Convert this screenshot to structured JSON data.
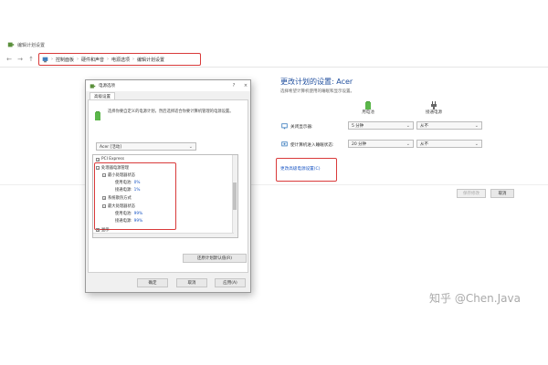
{
  "window": {
    "title": "编辑计划设置"
  },
  "address": {
    "back": "←",
    "forward": "→",
    "up": "↑",
    "crumbs": [
      "控制面板",
      "硬件和声音",
      "电源选项",
      "编辑计划设置"
    ]
  },
  "plan": {
    "heading": "更改计划的设置: Acer",
    "subtext": "选择希望计算机使用的睡眠和显示设置。",
    "col_battery": "用电池",
    "col_plugged": "接通电源",
    "rows": [
      {
        "label": "关闭显示器:",
        "battery": "5 分钟",
        "plugged": "从不"
      },
      {
        "label": "使计算机进入睡眠状态:",
        "battery": "20 分钟",
        "plugged": "从不"
      }
    ],
    "advanced_link": "更改高级电源设置(C)",
    "save_button": "保存修改",
    "cancel_button": "取消"
  },
  "dialog": {
    "title": "电源选项",
    "help": "?",
    "close": "×",
    "tab": "高级设置",
    "description": "选择你要自定义的电源计划，然后选择适合你要计算机管理的电源设置。",
    "plan_select": "Acer [活动]",
    "tree": {
      "pci": "PCI Express",
      "processor": "处理器电源管理",
      "min_state": "最小处理器状态",
      "min_battery_label": "使用电池:",
      "min_battery_value": "0%",
      "min_plugged_label": "接通电源:",
      "min_plugged_value": "1%",
      "cooling": "系统散热方式",
      "max_state": "最大处理器状态",
      "max_battery_label": "使用电池:",
      "max_battery_value": "99%",
      "max_plugged_label": "接通电源:",
      "max_plugged_value": "99%",
      "display": "显示"
    },
    "restore_button": "还原计划默认值(R)",
    "ok_button": "确定",
    "cancel_button": "取消",
    "apply_button": "应用(A)"
  },
  "watermark": "知乎 @Chen.Java",
  "colors": {
    "highlight_box": "#d93a3a",
    "link": "#1a56c4",
    "heading": "#1f4e9e"
  }
}
